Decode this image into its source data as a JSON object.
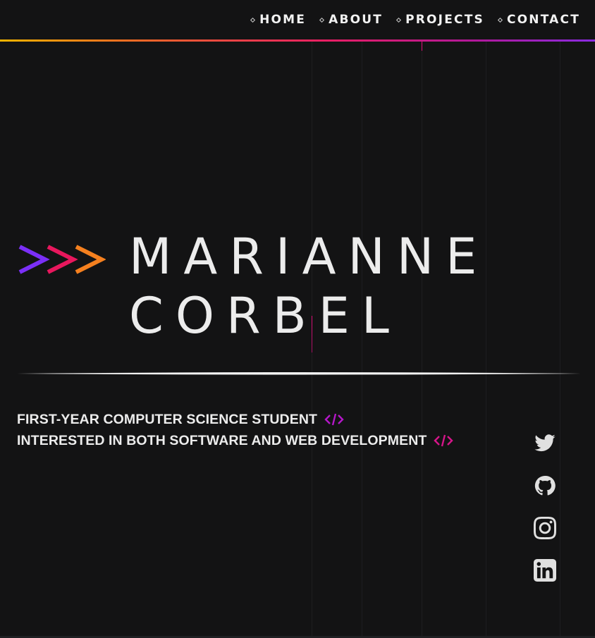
{
  "nav": {
    "items": [
      {
        "label": "HOME"
      },
      {
        "label": "ABOUT"
      },
      {
        "label": "PROJECTS"
      },
      {
        "label": "CONTACT"
      }
    ]
  },
  "hero": {
    "prompt_symbol": ">>>",
    "first_name": "MARIANNE",
    "last_name": "CORBEL",
    "taglines": [
      "FIRST-YEAR COMPUTER SCIENCE STUDENT",
      "INTERESTED IN BOTH SOFTWARE AND WEB DEVELOPMENT"
    ],
    "code_icon": "code-brackets-icon"
  },
  "socials": [
    {
      "icon": "twitter-icon"
    },
    {
      "icon": "github-icon"
    },
    {
      "icon": "instagram-icon"
    },
    {
      "icon": "linkedin-icon"
    }
  ],
  "colors": {
    "background": "#131314",
    "text": "#ececec",
    "chevron_1": "#7b2ff7",
    "chevron_2": "#e8175d",
    "chevron_3": "#f5801f",
    "code_icon_1": "#b517c9",
    "code_icon_2": "#d6158a",
    "nav_gradient": [
      "#f4b400",
      "#e81e64",
      "#8a2be2"
    ]
  }
}
